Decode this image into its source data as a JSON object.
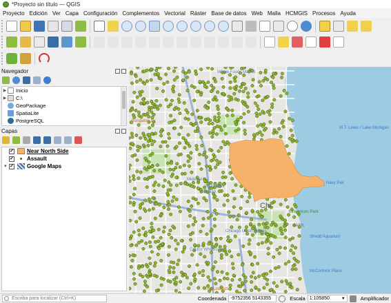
{
  "window": {
    "title": "*Proyecto sin título — QGIS"
  },
  "menu": [
    {
      "label": "Proyecto"
    },
    {
      "label": "Edición"
    },
    {
      "label": "Ver"
    },
    {
      "label": "Capa"
    },
    {
      "label": "Configuración"
    },
    {
      "label": "Complementos"
    },
    {
      "label": "Vectorial"
    },
    {
      "label": "Ráster"
    },
    {
      "label": "Base de datos"
    },
    {
      "label": "Web"
    },
    {
      "label": "Malla"
    },
    {
      "label": "HCMGIS"
    },
    {
      "label": "Procesos"
    },
    {
      "label": "Ayuda"
    }
  ],
  "navigator": {
    "title": "Navegador",
    "items": [
      {
        "label": "Inicio",
        "icon": "home-folder-icon",
        "expandable": true
      },
      {
        "label": "C:\\",
        "icon": "drive-icon",
        "expandable": true
      },
      {
        "label": "GeoPackage",
        "icon": "geopackage-icon",
        "expandable": false
      },
      {
        "label": "SpatiaLite",
        "icon": "spatialite-icon",
        "expandable": false
      },
      {
        "label": "PostgreSQL",
        "icon": "postgresql-icon",
        "expandable": false
      }
    ]
  },
  "layers": {
    "title": "Capas",
    "items": [
      {
        "label": "Near North Side",
        "checked": true,
        "symbol_color": "#f4b065",
        "underline": true
      },
      {
        "label": "Assault",
        "checked": true,
        "symbol_color": "#8dbb2a",
        "underline": false
      },
      {
        "label": "Google Maps",
        "checked": true,
        "symbol_color": "#3a6ea5",
        "underline": false
      }
    ]
  },
  "map": {
    "labels": [
      {
        "text": "Whole Foods Market"
      },
      {
        "text": "Bungalow by"
      },
      {
        "text": "Midwest"
      },
      {
        "text": "Walgreens"
      },
      {
        "text": "Chicago"
      },
      {
        "text": "Chi"
      },
      {
        "text": "Costco Wholesale"
      },
      {
        "text": "The Lookout"
      },
      {
        "text": "Chicago Union Station"
      },
      {
        "text": "Millennium Park"
      },
      {
        "text": "PARK"
      },
      {
        "text": "Shedd Aquarium"
      },
      {
        "text": "McCormick Place"
      },
      {
        "text": "Navy Pier"
      },
      {
        "text": "M.T. Lewis / Lake Michigan"
      }
    ],
    "colors": {
      "water": "#9ccbe2",
      "land": "#e8e6e2",
      "polygon": "#f7b26a",
      "points": "#8db72c",
      "park": "#c8e4b4"
    }
  },
  "status": {
    "locator_placeholder": "Escriba para localizar (Ctrl+K)",
    "coord_label": "Coordenada",
    "coord_value": "-9752356  5143355",
    "scale_label": "Escala",
    "scale_value": "1:105850",
    "magnifier_label": "Amplificador"
  }
}
